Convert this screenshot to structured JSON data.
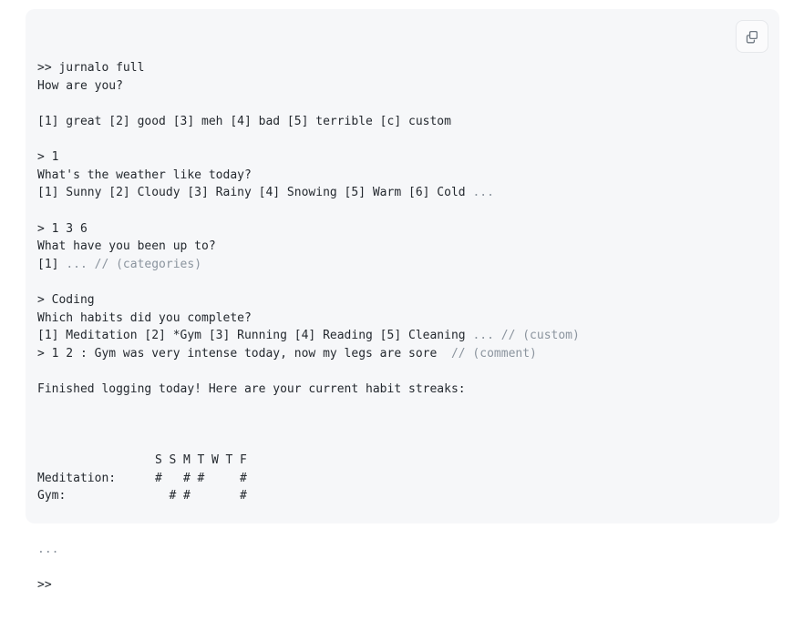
{
  "panel": {
    "background_color": "#f6f7f9",
    "text_color": "#24292f",
    "dim_color": "#8b949e",
    "muted_color": "#6e7781"
  },
  "copy_button": {
    "icon": "copy-icon",
    "label": "Copy"
  },
  "console": {
    "lines": [
      {
        "type": "text",
        "text": ">> jurnalo full"
      },
      {
        "type": "text",
        "text": "How are you?"
      },
      {
        "type": "blank",
        "text": ""
      },
      {
        "type": "text",
        "text": "[1] great [2] good [3] meh [4] bad [5] terrible [c] custom"
      },
      {
        "type": "blank",
        "text": ""
      },
      {
        "type": "text",
        "text": "> 1"
      },
      {
        "type": "text",
        "text": "What's the weather like today?"
      },
      {
        "type": "mixed",
        "text": "[1] Sunny [2] Cloudy [3] Rainy [4] Snowing [5] Warm [6] Cold ",
        "dim": "..."
      },
      {
        "type": "blank",
        "text": ""
      },
      {
        "type": "text",
        "text": "> 1 3 6"
      },
      {
        "type": "text",
        "text": "What have you been up to?"
      },
      {
        "type": "mixed",
        "text": "[1] ",
        "dim": "... // (categories)"
      },
      {
        "type": "blank",
        "text": ""
      },
      {
        "type": "text",
        "text": "> Coding"
      },
      {
        "type": "text",
        "text": "Which habits did you complete?"
      },
      {
        "type": "mixed",
        "text": "[1] Meditation [2] *Gym [3] Running [4] Reading [5] Cleaning ",
        "dim": "... // (custom)"
      },
      {
        "type": "mixed",
        "text": "> 1 2 : Gym was very intense today, now my legs are sore  ",
        "dim": "// (comment)"
      },
      {
        "type": "blank",
        "text": ""
      },
      {
        "type": "text",
        "text": "Finished logging today! Here are your current habit streaks:"
      },
      {
        "type": "blank",
        "text": ""
      }
    ],
    "trailing": [
      {
        "type": "dim",
        "text": "..."
      },
      {
        "type": "blank",
        "text": ""
      },
      {
        "type": "text",
        "text": ">>"
      }
    ]
  },
  "streaks": {
    "day_headers": [
      "S",
      "S",
      "M",
      "T",
      "W",
      "T",
      "F"
    ],
    "mark": "#",
    "rows": [
      {
        "label": "Meditation:",
        "marks": [
          true,
          false,
          true,
          true,
          false,
          false,
          true
        ]
      },
      {
        "label": "Gym:",
        "marks": [
          false,
          true,
          true,
          false,
          false,
          false,
          true
        ]
      }
    ]
  }
}
